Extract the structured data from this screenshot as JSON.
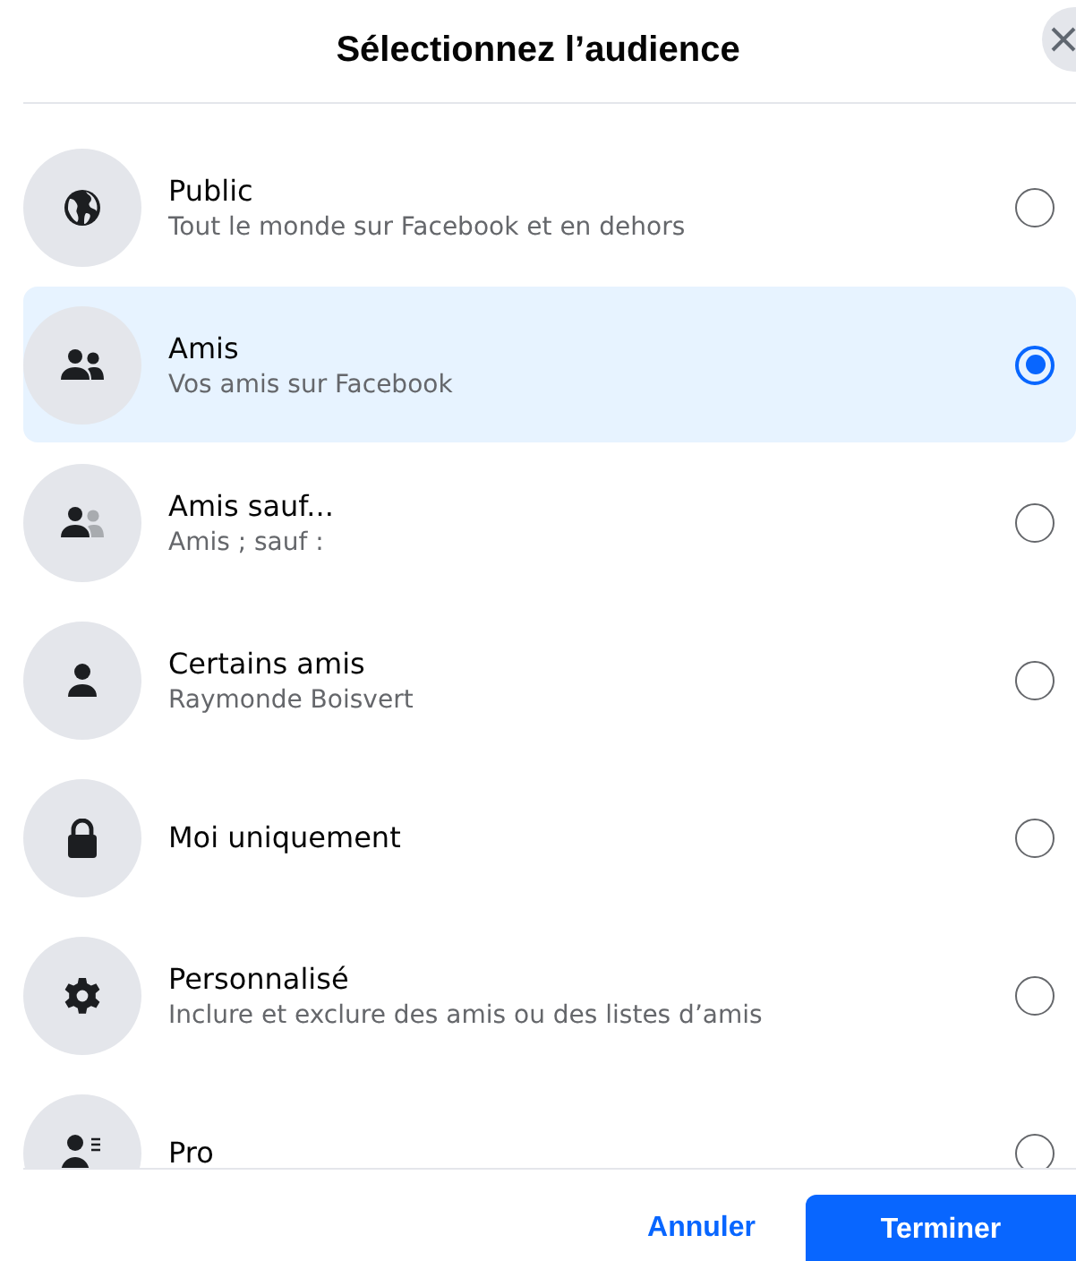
{
  "dialog": {
    "title": "Sélectionnez l’audience"
  },
  "options": [
    {
      "kind": "globe",
      "title": "Public",
      "subtitle": "Tout le monde sur Facebook et en dehors",
      "selected": false
    },
    {
      "kind": "friends",
      "title": "Amis",
      "subtitle": "Vos amis sur Facebook",
      "selected": true
    },
    {
      "kind": "friends-except",
      "title": "Amis sauf...",
      "subtitle": "Amis ; sauf :",
      "selected": false
    },
    {
      "kind": "person",
      "title": "Certains amis",
      "subtitle": "Raymonde Boisvert",
      "selected": false
    },
    {
      "kind": "lock",
      "title": "Moi uniquement",
      "selected": false
    },
    {
      "kind": "gear",
      "title": "Personnalisé",
      "subtitle": "Inclure et exclure des amis ou des listes d’amis",
      "selected": false
    },
    {
      "kind": "person-list",
      "title": "Pro",
      "selected": false
    }
  ],
  "buttons": {
    "cancel": "Annuler",
    "done": "Terminer"
  }
}
